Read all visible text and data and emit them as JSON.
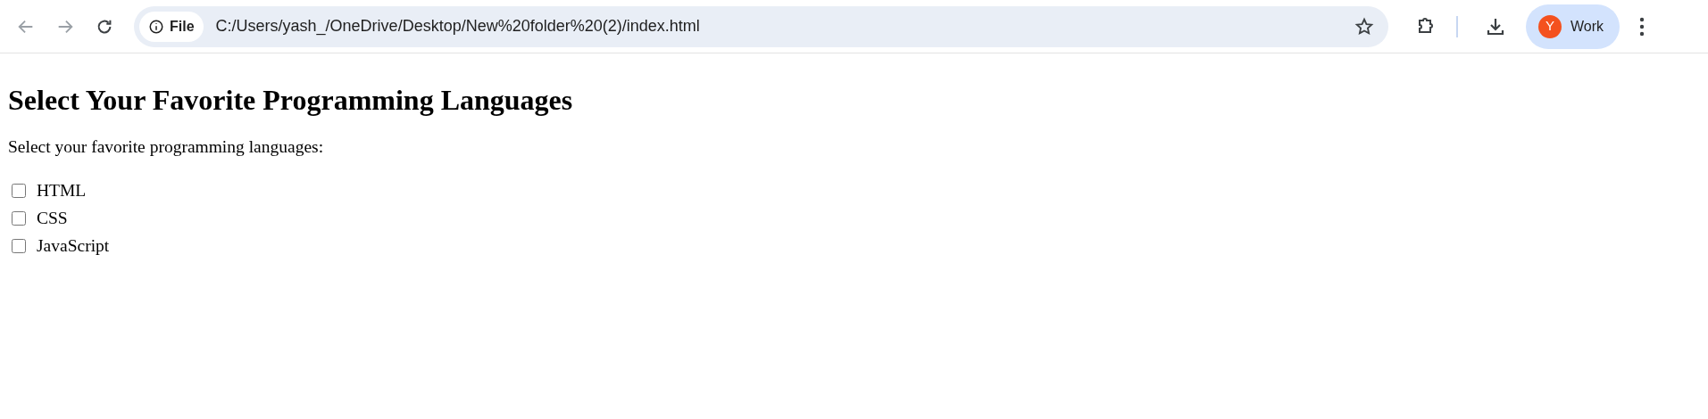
{
  "browser": {
    "address_badge": "File",
    "url": "C:/Users/yash_/OneDrive/Desktop/New%20folder%20(2)/index.html",
    "profile_initial": "Y",
    "profile_name": "Work"
  },
  "page": {
    "heading": "Select Your Favorite Programming Languages",
    "prompt": "Select your favorite programming languages:",
    "options": [
      {
        "label": "HTML",
        "checked": false
      },
      {
        "label": "CSS",
        "checked": false
      },
      {
        "label": "JavaScript",
        "checked": false
      }
    ]
  }
}
